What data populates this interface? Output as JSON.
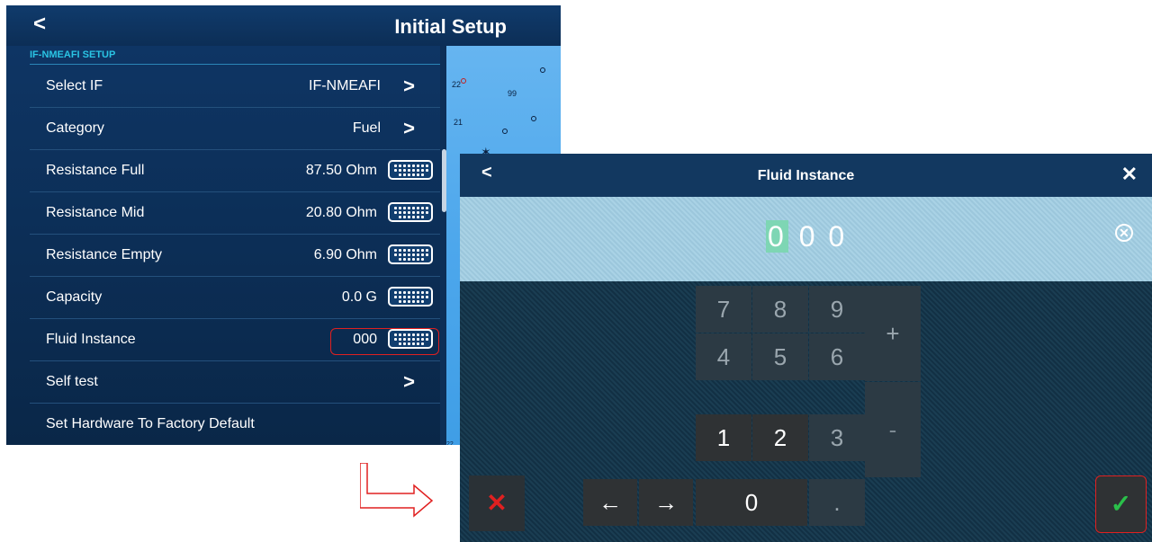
{
  "setup": {
    "back_glyph": "<",
    "title": "Initial Setup",
    "section": "IF-NMEAFI SETUP",
    "rows": [
      {
        "label": "Select IF",
        "value": "IF-NMEAFI",
        "control": "arrow"
      },
      {
        "label": "Category",
        "value": "Fuel",
        "control": "arrow"
      },
      {
        "label": "Resistance Full",
        "value": "87.50 Ohm",
        "control": "keyboard"
      },
      {
        "label": "Resistance Mid",
        "value": "20.80 Ohm",
        "control": "keyboard"
      },
      {
        "label": "Resistance Empty",
        "value": "6.90 Ohm",
        "control": "keyboard"
      },
      {
        "label": "Capacity",
        "value": "0.0 G",
        "control": "keyboard"
      },
      {
        "label": "Fluid Instance",
        "value": "000",
        "control": "keyboard"
      },
      {
        "label": "Self test",
        "value": "",
        "control": "arrow"
      },
      {
        "label": "Set Hardware To Factory Default",
        "value": "",
        "control": "none"
      }
    ],
    "arrow_glyph": ">"
  },
  "fluid": {
    "back_glyph": "<",
    "title": "Fluid Instance",
    "close_glyph": "✕",
    "display_first": "0",
    "display_rest": "0 0",
    "clear_glyph": "✕",
    "keys": {
      "k7": "7",
      "k8": "8",
      "k9": "9",
      "k4": "4",
      "k5": "5",
      "k6": "6",
      "k1": "1",
      "k2": "2",
      "k3": "3",
      "k0": "0",
      "plus": "+",
      "minus": "-",
      "dot": ".",
      "left": "←",
      "right": "→"
    },
    "cancel_glyph": "✕",
    "ok_glyph": "✓"
  },
  "colors": {
    "accent": "#2ac4e4",
    "highlight": "#e02020",
    "ok": "#2ac04a"
  }
}
